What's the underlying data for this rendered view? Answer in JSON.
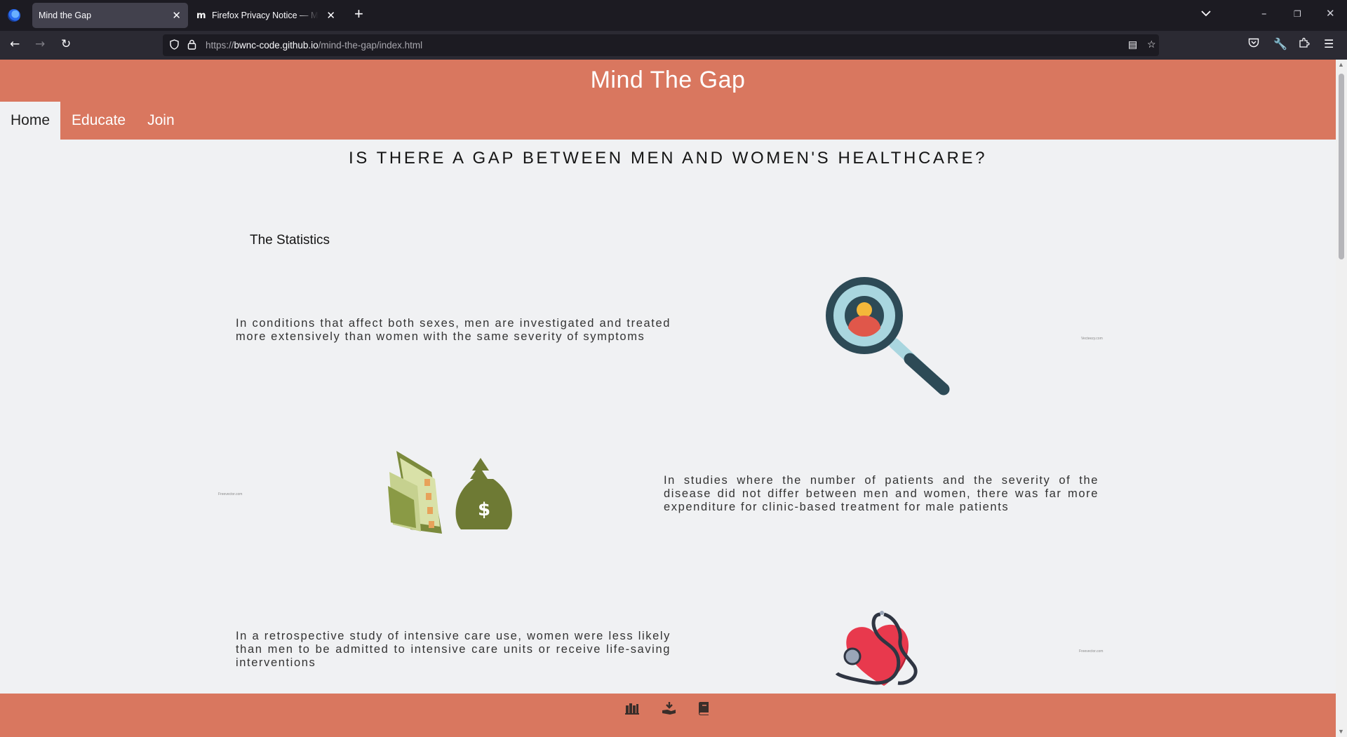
{
  "browser": {
    "tabs": [
      {
        "title": "Mind the Gap",
        "active": true
      },
      {
        "title": "Firefox Privacy Notice — Mozilla",
        "active": false,
        "favicon": "m"
      }
    ],
    "new_tab": "+",
    "url_domain": "bwnc-code.github.io",
    "url_prefix": "https://",
    "url_path": "/mind-the-gap/index.html"
  },
  "site": {
    "title": "Mind The Gap",
    "menu": [
      "Home",
      "Educate",
      "Join"
    ],
    "active_menu": "Home"
  },
  "main": {
    "headline": "IS THERE A GAP BETWEEN MEN AND WOMEN'S HEALTHCARE?",
    "section_title": "The Statistics",
    "stats": [
      {
        "text": "In conditions that affect both sexes, men are investigated and treated more extensively than women with the same severity of symptoms",
        "image": "magnifier-person-icon",
        "credit": "Vecteezy.com"
      },
      {
        "text": "In studies where the number of patients and the severity of the disease did not differ between men and women, there was far more expenditure for clinic-based treatment for male patients",
        "image": "money-bag-icon",
        "credit": "Freevector.com"
      },
      {
        "text": "In a retrospective study of intensive care use, women were less likely than men to be admitted to intensive care units or receive life-saving interventions",
        "image": "heart-stethoscope-icon",
        "credit": "Freevector.com"
      }
    ]
  },
  "footer": {
    "icons": [
      "library-icon",
      "donate-icon",
      "book-icon"
    ]
  },
  "colors": {
    "accent": "#d9775f",
    "page_bg": "#f0f1f3",
    "chrome_dark": "#1c1b22",
    "chrome_mid": "#2b2a33"
  }
}
